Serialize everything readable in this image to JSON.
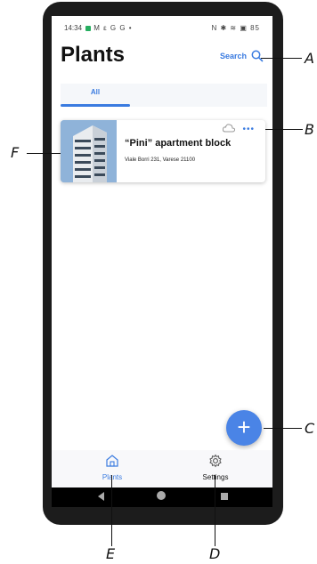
{
  "status_bar": {
    "time": "14:34",
    "left_icons": "M ε G G •",
    "right_icons": "N ✱ ≋ ▣ 85"
  },
  "header": {
    "title": "Plants",
    "search_label": "Search"
  },
  "tabs": [
    {
      "label": "All",
      "selected": true
    }
  ],
  "plants": [
    {
      "name": "“Pini” apartment block",
      "address": "Viale Borri 231, Varese 21100"
    }
  ],
  "fab": {
    "symbol": "+"
  },
  "bottom_nav": {
    "items": [
      {
        "label": "Plants",
        "icon": "home-icon",
        "active": true
      },
      {
        "label": "Settings",
        "icon": "gear-icon",
        "active": false
      }
    ]
  },
  "annotations": {
    "A": "A",
    "B": "B",
    "C": "C",
    "D": "D",
    "E": "E",
    "F": "F"
  },
  "colors": {
    "accent": "#3a7be0",
    "fab": "#4a84e6",
    "frame": "#1c1c1c"
  }
}
